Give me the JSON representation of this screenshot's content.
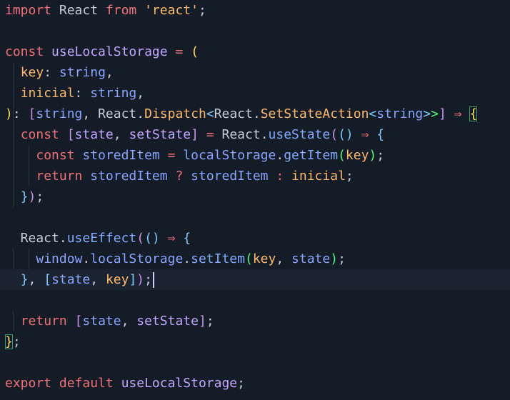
{
  "editor": {
    "lines": [
      [
        [
          "kw",
          "import"
        ],
        [
          "tx",
          " React "
        ],
        [
          "kw",
          "from"
        ],
        [
          "tx",
          " "
        ],
        [
          "st",
          "'react'"
        ],
        [
          "tx",
          ";"
        ]
      ],
      [],
      [
        [
          "kw",
          "const"
        ],
        [
          "tx",
          " "
        ],
        [
          "id",
          "useLocalStorage"
        ],
        [
          "tx",
          " "
        ],
        [
          "op",
          "="
        ],
        [
          "tx",
          " "
        ],
        [
          "p1",
          "("
        ]
      ],
      [
        [
          "tx",
          "  "
        ],
        [
          "st",
          "key"
        ],
        [
          "tx",
          ": "
        ],
        [
          "ty",
          "string"
        ],
        [
          "tx",
          ","
        ]
      ],
      [
        [
          "tx",
          "  "
        ],
        [
          "st",
          "inicial"
        ],
        [
          "tx",
          ": "
        ],
        [
          "ty",
          "string"
        ],
        [
          "tx",
          ","
        ]
      ],
      [
        [
          "p1",
          ")"
        ],
        [
          "tx",
          ": "
        ],
        [
          "p2",
          "["
        ],
        [
          "ty",
          "string"
        ],
        [
          "tx",
          ", React."
        ],
        [
          "st",
          "Dispatch"
        ],
        [
          "p3",
          "<"
        ],
        [
          "tx",
          "React."
        ],
        [
          "st",
          "SetStateAction"
        ],
        [
          "p3",
          "<"
        ],
        [
          "ty",
          "string"
        ],
        [
          "p3",
          ">"
        ],
        [
          "p4",
          ">"
        ],
        [
          "p2",
          "]"
        ],
        [
          "tx",
          " "
        ],
        [
          "op",
          "⇒"
        ],
        [
          "tx",
          " "
        ],
        [
          "p1",
          "{"
        ]
      ],
      [
        [
          "tx",
          "  "
        ],
        [
          "kw",
          "const"
        ],
        [
          "tx",
          " "
        ],
        [
          "p2",
          "["
        ],
        [
          "id",
          "state"
        ],
        [
          "tx",
          ", "
        ],
        [
          "id",
          "setState"
        ],
        [
          "p2",
          "]"
        ],
        [
          "tx",
          " "
        ],
        [
          "op",
          "="
        ],
        [
          "tx",
          " React."
        ],
        [
          "fn",
          "useState"
        ],
        [
          "p2",
          "("
        ],
        [
          "p3",
          "("
        ],
        [
          "p3",
          ")"
        ],
        [
          "tx",
          " "
        ],
        [
          "op",
          "⇒"
        ],
        [
          "tx",
          " "
        ],
        [
          "p3",
          "{"
        ]
      ],
      [
        [
          "tx",
          "    "
        ],
        [
          "kw",
          "const"
        ],
        [
          "tx",
          " "
        ],
        [
          "ty",
          "storedItem"
        ],
        [
          "tx",
          " "
        ],
        [
          "op",
          "="
        ],
        [
          "tx",
          " "
        ],
        [
          "ty",
          "localStorage"
        ],
        [
          "tx",
          "."
        ],
        [
          "fn",
          "getItem"
        ],
        [
          "p4",
          "("
        ],
        [
          "st",
          "key"
        ],
        [
          "p4",
          ")"
        ],
        [
          "tx",
          ";"
        ]
      ],
      [
        [
          "tx",
          "    "
        ],
        [
          "kw",
          "return"
        ],
        [
          "tx",
          " "
        ],
        [
          "ty",
          "storedItem"
        ],
        [
          "tx",
          " "
        ],
        [
          "op",
          "?"
        ],
        [
          "tx",
          " "
        ],
        [
          "ty",
          "storedItem"
        ],
        [
          "tx",
          " "
        ],
        [
          "op",
          ":"
        ],
        [
          "tx",
          " "
        ],
        [
          "st",
          "inicial"
        ],
        [
          "tx",
          ";"
        ]
      ],
      [
        [
          "tx",
          "  "
        ],
        [
          "p3",
          "}"
        ],
        [
          "p2",
          ")"
        ],
        [
          "tx",
          ";"
        ]
      ],
      [],
      [
        [
          "tx",
          "  React."
        ],
        [
          "fn",
          "useEffect"
        ],
        [
          "p2",
          "("
        ],
        [
          "p3",
          "("
        ],
        [
          "p3",
          ")"
        ],
        [
          "tx",
          " "
        ],
        [
          "op",
          "⇒"
        ],
        [
          "tx",
          " "
        ],
        [
          "p3",
          "{"
        ]
      ],
      [
        [
          "tx",
          "    "
        ],
        [
          "ty",
          "window"
        ],
        [
          "tx",
          "."
        ],
        [
          "ty",
          "localStorage"
        ],
        [
          "tx",
          "."
        ],
        [
          "fn",
          "setItem"
        ],
        [
          "p4",
          "("
        ],
        [
          "st",
          "key"
        ],
        [
          "tx",
          ", "
        ],
        [
          "ty",
          "state"
        ],
        [
          "p4",
          ")"
        ],
        [
          "tx",
          ";"
        ]
      ],
      [
        [
          "tx",
          "  "
        ],
        [
          "p3",
          "}"
        ],
        [
          "tx",
          ", "
        ],
        [
          "p3",
          "["
        ],
        [
          "ty",
          "state"
        ],
        [
          "tx",
          ", "
        ],
        [
          "st",
          "key"
        ],
        [
          "p3",
          "]"
        ],
        [
          "p2",
          ")"
        ],
        [
          "tx",
          ";"
        ]
      ],
      [],
      [
        [
          "tx",
          "  "
        ],
        [
          "kw",
          "return"
        ],
        [
          "tx",
          " "
        ],
        [
          "p2",
          "["
        ],
        [
          "ty",
          "state"
        ],
        [
          "tx",
          ", "
        ],
        [
          "id",
          "setState"
        ],
        [
          "p2",
          "]"
        ],
        [
          "tx",
          ";"
        ]
      ],
      [
        [
          "p1",
          "}"
        ],
        [
          "tx",
          ";"
        ]
      ],
      [],
      [
        [
          "kw",
          "export"
        ],
        [
          "tx",
          " "
        ],
        [
          "kw",
          "default"
        ],
        [
          "tx",
          " "
        ],
        [
          "id",
          "useLocalStorage"
        ],
        [
          "tx",
          ";"
        ]
      ]
    ]
  },
  "colors": {
    "background": "#141c27",
    "active_line": "#1a2330",
    "keyword": "#f07178",
    "string": "#ffb86c",
    "type": "#8aa4ff"
  }
}
